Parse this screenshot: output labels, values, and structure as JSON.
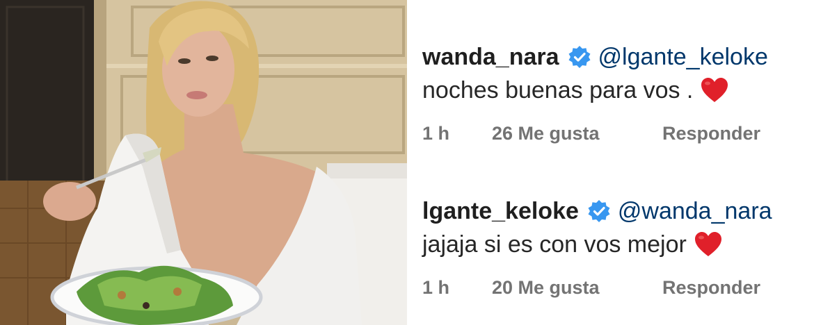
{
  "photo": {
    "icon": "photo-of-woman-eating-salad"
  },
  "comments": [
    {
      "username": "wanda_nara",
      "verified_icon": "verified-badge-icon",
      "mention": "@lgante_keloke",
      "text": "noches buenas para vos .",
      "reaction_icon": "red-heart-emoji",
      "time": "1 h",
      "likes": "26 Me gusta",
      "reply_label": "Responder"
    },
    {
      "username": "lgante_keloke",
      "verified_icon": "verified-badge-icon",
      "mention": "@wanda_nara",
      "text": "jajaja si es con vos mejor",
      "reaction_icon": "red-heart-emoji",
      "time": "1 h",
      "likes": "20 Me gusta",
      "reply_label": "Responder"
    }
  ],
  "colors": {
    "verified": "#3897f0",
    "mention": "#00376b",
    "meta": "#737373",
    "heart": "#e0202a"
  }
}
